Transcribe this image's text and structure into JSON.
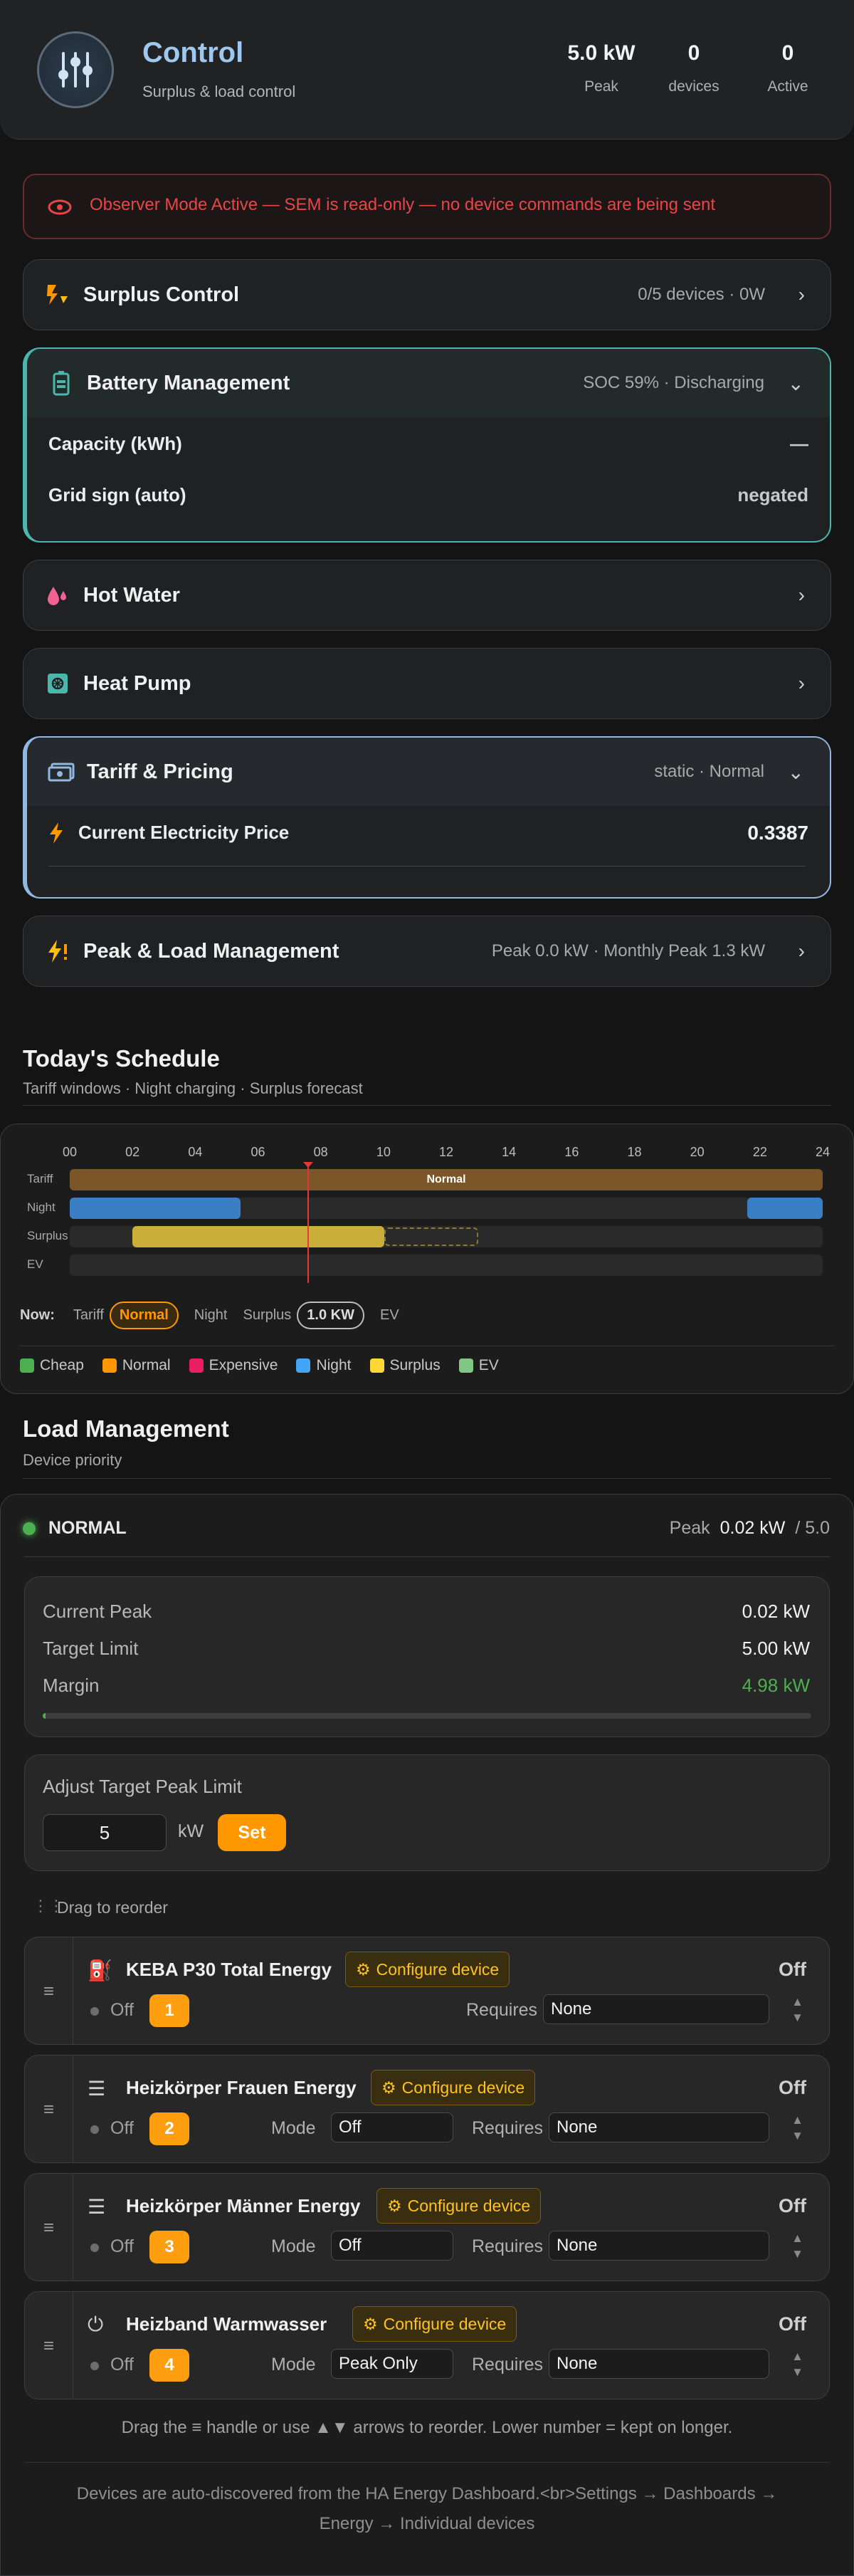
{
  "header": {
    "title": "Control",
    "subtitle": "Surplus & load control",
    "stats": [
      {
        "value": "5.0 kW",
        "label": "Peak"
      },
      {
        "value": "0",
        "label": "devices"
      },
      {
        "value": "0",
        "label": "Active"
      }
    ]
  },
  "banner": {
    "text": "Observer Mode Active — SEM is read-only — no device commands are being sent"
  },
  "sections": {
    "surplus": {
      "title": "Surplus Control",
      "summary": "0/5 devices · 0W"
    },
    "battery": {
      "title": "Battery Management",
      "summary": "SOC 59% · Discharging",
      "rows": [
        {
          "label": "Capacity (kWh)",
          "value": "—"
        },
        {
          "label": "Grid sign (auto)",
          "value": "negated"
        }
      ]
    },
    "hot_water": {
      "title": "Hot Water"
    },
    "heat_pump": {
      "title": "Heat Pump"
    },
    "tariff": {
      "title": "Tariff & Pricing",
      "summary": "static · Normal",
      "price_label": "Current Electricity Price",
      "price_value": "0.3387"
    },
    "peak": {
      "title": "Peak & Load Management",
      "summary": "Peak 0.0 kW · Monthly Peak 1.3 kW"
    }
  },
  "schedule": {
    "title": "Today's Schedule",
    "subtitle": "Tariff windows · Night charging · Surplus forecast",
    "hours": [
      "00",
      "02",
      "04",
      "06",
      "08",
      "10",
      "12",
      "14",
      "16",
      "18",
      "20",
      "22",
      "24"
    ],
    "lanes": [
      "Tariff",
      "Night",
      "Surplus",
      "EV"
    ],
    "tariff_band_label": "Normal",
    "now": {
      "label": "Now:",
      "tariff_label": "Tariff",
      "tariff_value": "Normal",
      "night_label": "Night",
      "surplus_label": "Surplus",
      "surplus_value": "1.0 KW",
      "ev_label": "EV"
    },
    "legend": [
      {
        "label": "Cheap",
        "color": "#4caf50"
      },
      {
        "label": "Normal",
        "color": "#ff9800"
      },
      {
        "label": "Expensive",
        "color": "#e91e63"
      },
      {
        "label": "Night",
        "color": "#42a5f5"
      },
      {
        "label": "Surplus",
        "color": "#fdd835"
      },
      {
        "label": "EV",
        "color": "#81c784"
      }
    ]
  },
  "load": {
    "title": "Load Management",
    "subtitle": "Device priority",
    "status": "NORMAL",
    "peak_label": "Peak",
    "peak_value": "0.02 kW",
    "peak_limit": "/ 5.0",
    "current_peak_label": "Current Peak",
    "current_peak": "0.02 kW",
    "target_label": "Target Limit",
    "target": "5.00 kW",
    "margin_label": "Margin",
    "margin": "4.98 kW",
    "margin_bar_fraction": 0.004,
    "adjust_label": "Adjust Target Peak Limit",
    "adjust_value": "5",
    "adjust_unit": "kW",
    "set_label": "Set",
    "drag_hint": "Drag to reorder",
    "devices": [
      {
        "name": "KEBA P30 Total Energy",
        "configure": "Configure device",
        "state": "Off",
        "off": "Off",
        "priority": "1",
        "mode_label": "",
        "mode": "",
        "requires_label": "Requires",
        "requires": "None"
      },
      {
        "name": "Heizkörper Frauen Energy",
        "configure": "Configure device",
        "state": "Off",
        "off": "Off",
        "priority": "2",
        "mode_label": "Mode",
        "mode": "Off",
        "requires_label": "Requires",
        "requires": "None"
      },
      {
        "name": "Heizkörper Männer Energy",
        "configure": "Configure device",
        "state": "Off",
        "off": "Off",
        "priority": "3",
        "mode_label": "Mode",
        "mode": "Off",
        "requires_label": "Requires",
        "requires": "None"
      },
      {
        "name": "Heizband Warmwasser",
        "configure": "Configure device",
        "state": "Off",
        "off": "Off",
        "priority": "4",
        "mode_label": "Mode",
        "mode": "Peak Only",
        "requires_label": "Requires",
        "requires": "None"
      }
    ],
    "footer_hint": "Drag the ≡ handle or use ▲▼ arrows to reorder. Lower number = kept on longer.",
    "footer_info": "Devices are auto-discovered from the HA Energy Dashboard.<br>Settings → Dashboards → Energy → Individual devices"
  }
}
